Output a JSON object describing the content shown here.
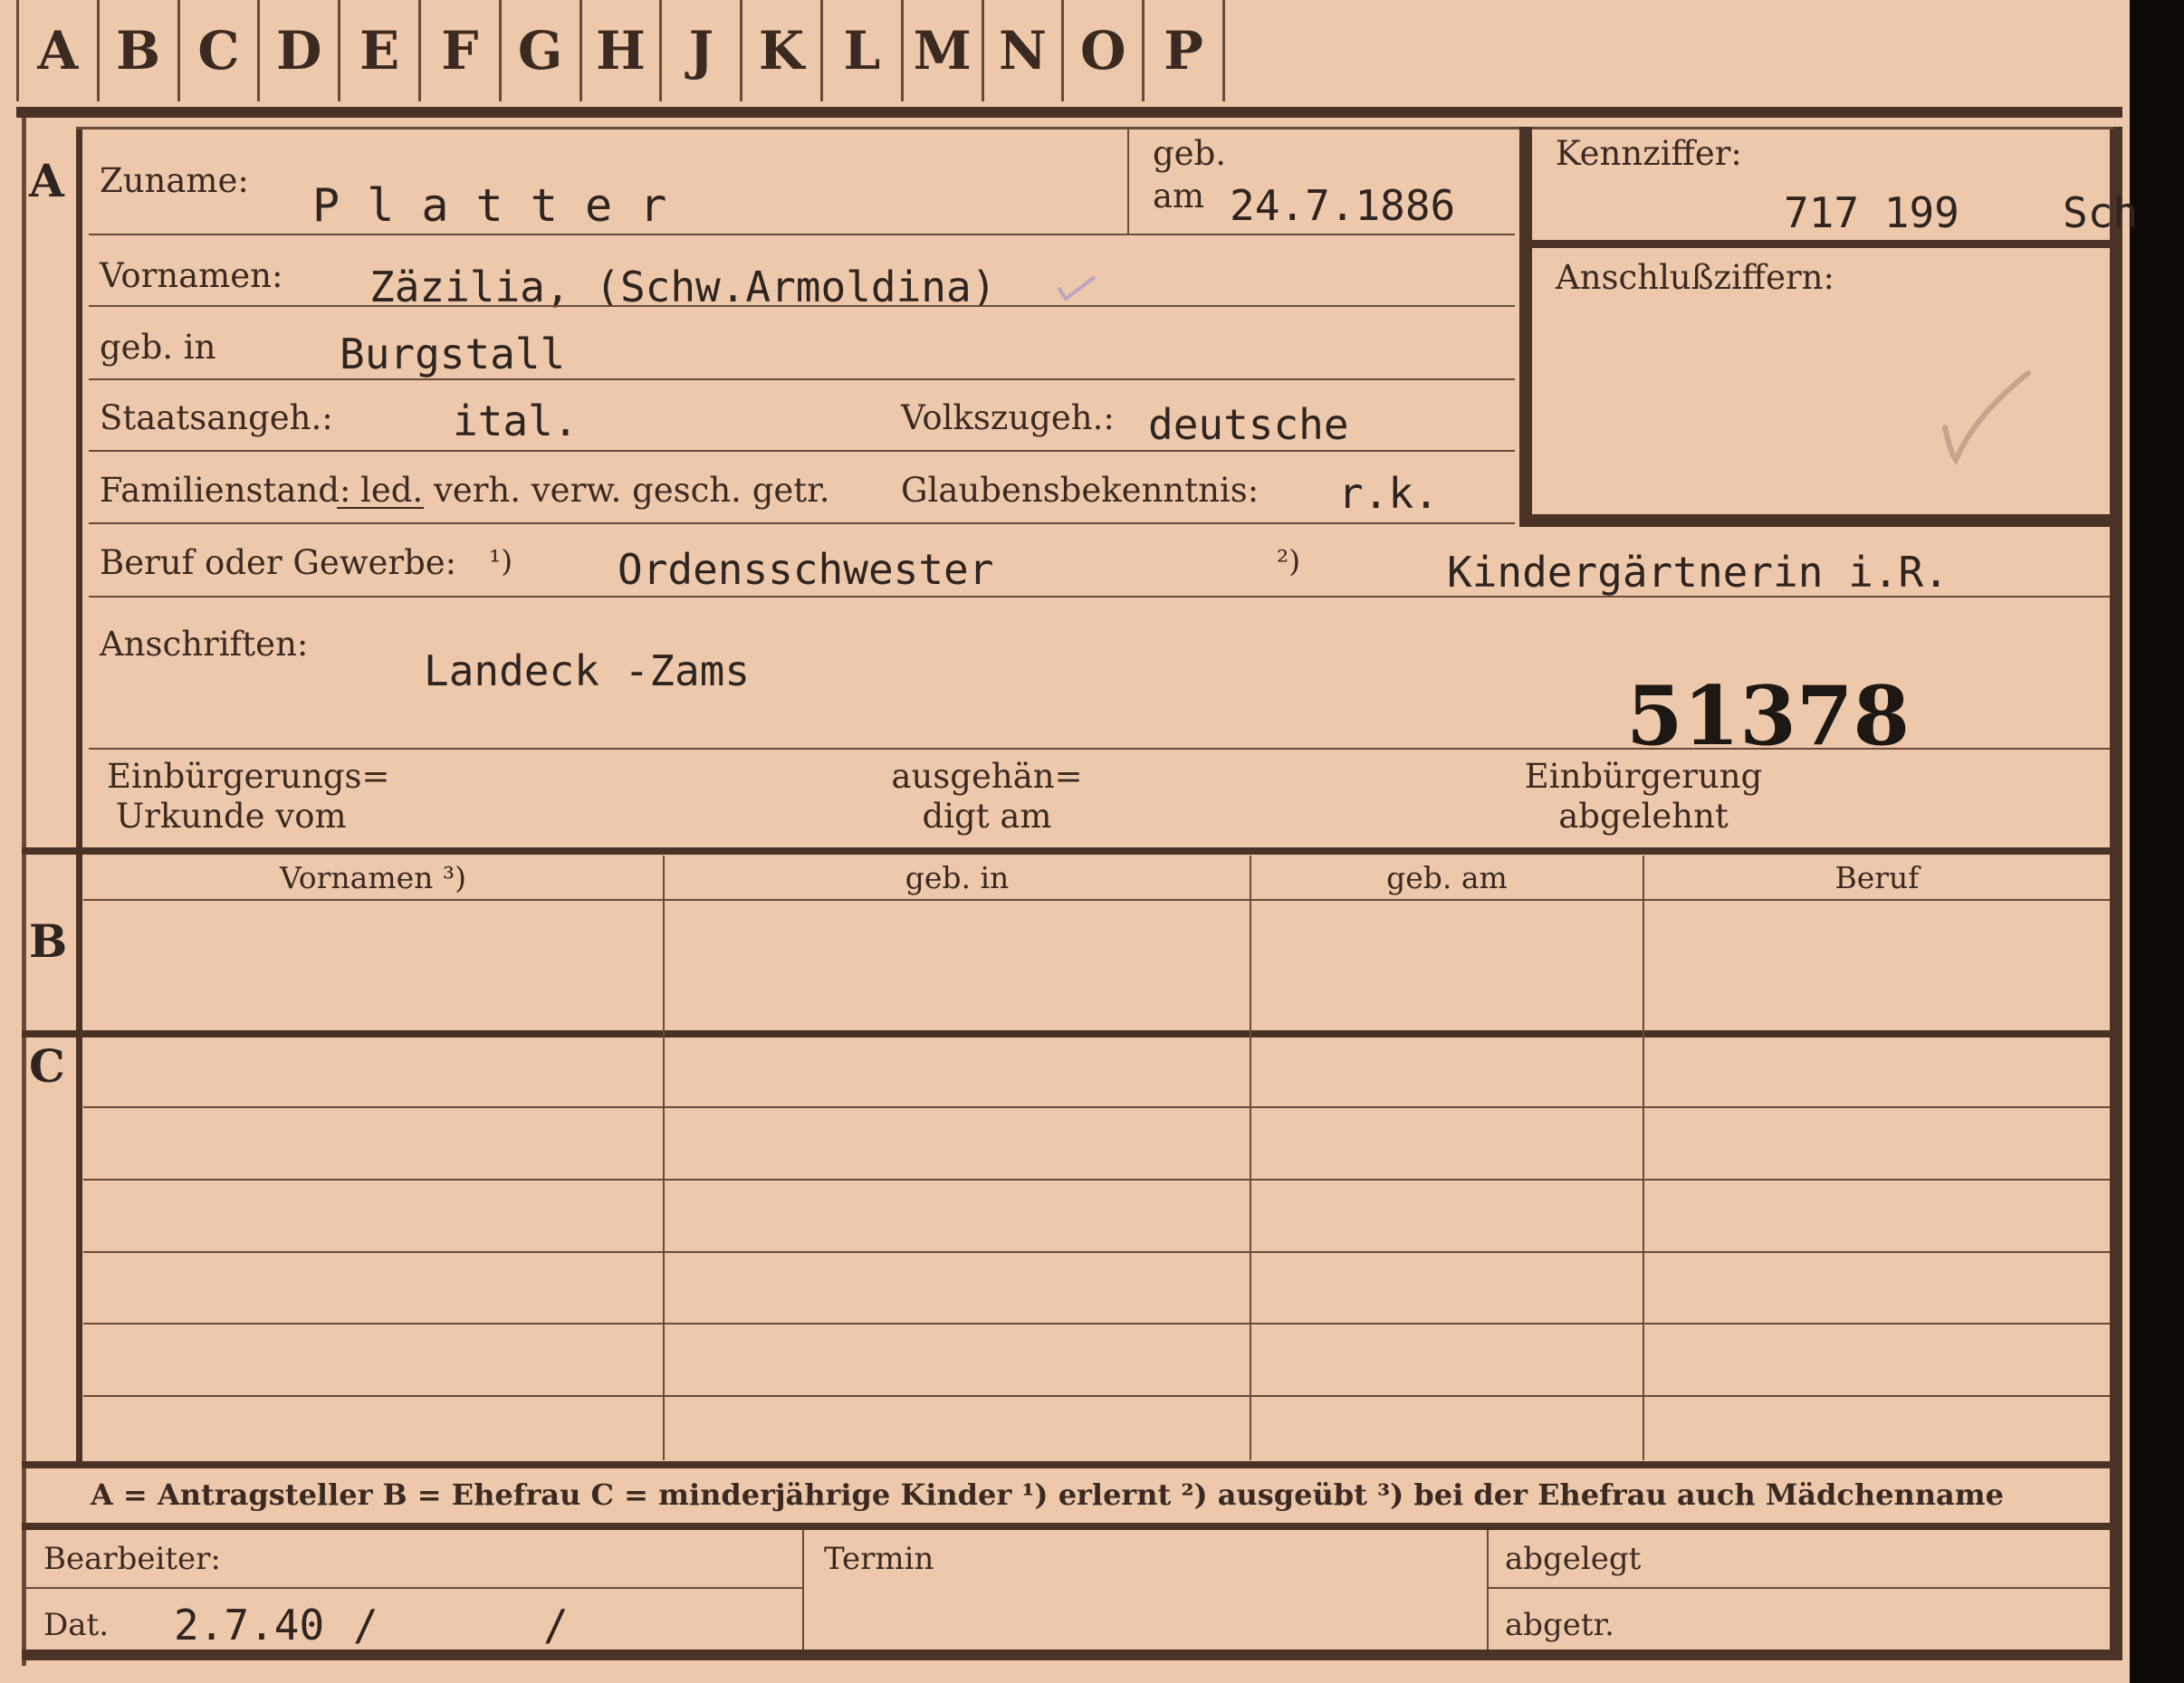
{
  "tabs": [
    "A",
    "B",
    "C",
    "D",
    "E",
    "F",
    "G",
    "H",
    "J",
    "K",
    "L",
    "M",
    "N",
    "O",
    "P"
  ],
  "side_labels": {
    "a": "A",
    "b": "B",
    "c": "C"
  },
  "fields": {
    "zuname_label": "Zuname:",
    "zuname_value": "P l a t t e r",
    "geb_label": "geb.",
    "am_label": "am",
    "geb_am_value": "24.7.1886",
    "kennziffer_label": "Kennziffer:",
    "kennziffer_value": "717 199",
    "kennziffer_suffix": "Sch",
    "vornamen_label": "Vornamen:",
    "vornamen_value": "Zäzilia, (Schw.Armoldina)",
    "anschluss_label": "Anschlußziffern:",
    "geb_in_label": "geb. in",
    "geb_in_value": "Burgstall",
    "staatsangeh_label": "Staatsangeh.:",
    "staatsangeh_value": "ital.",
    "volkszugeh_label": "Volkszugeh.:",
    "volkszugeh_value": "deutsche",
    "familienstand_label": "Familienstand:",
    "familienstand_options": "led. verh. verw. gesch. getr.",
    "glaubens_label": "Glaubensbekenntnis:",
    "glaubens_value": "r.k.",
    "beruf_label": "Beruf oder Gewerbe:",
    "fn1": "¹)",
    "beruf1_value": "Ordensschwester",
    "fn2": "²)",
    "beruf2_value": "Kindergärtnerin i.R.",
    "anschriften_label": "Anschriften:",
    "anschriften_value": "Landeck -Zams",
    "stamp_number": "51378",
    "einb_urkunde_line1": "Einbürgerungs=",
    "einb_urkunde_line2": "Urkunde vom",
    "ausgehaendigt_line1": "ausgehän=",
    "ausgehaendigt_line2": "digt am",
    "einb_abgelehnt_line1": "Einbürgerung",
    "einb_abgelehnt_line2": "abgelehnt"
  },
  "table_headers": [
    "Vornamen ³)",
    "geb. in",
    "geb. am",
    "Beruf"
  ],
  "legend": "A = Antragsteller   B = Ehefrau   C = minderjährige Kinder   ¹) erlernt   ²) ausgeübt   ³) bei der Ehefrau auch Mädchenname",
  "footer": {
    "bearbeiter_label": "Bearbeiter:",
    "dat_label": "Dat.",
    "dat_value": "2.7.40",
    "slash1": "/",
    "slash2": "/",
    "termin_label": "Termin",
    "abgelegt_label": "abgelegt",
    "abgetr_label": "abgetr."
  }
}
